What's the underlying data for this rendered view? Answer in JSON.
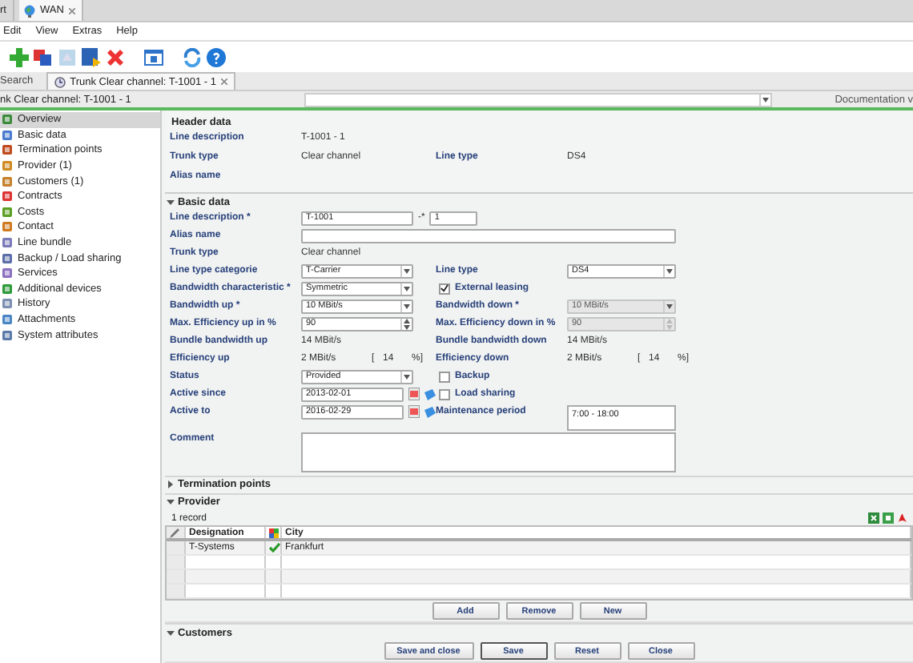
{
  "app_tabs": [
    {
      "label": "rt",
      "selected": false
    },
    {
      "label": "WAN",
      "selected": true
    }
  ],
  "menu": [
    "Edit",
    "View",
    "Extras",
    "Help"
  ],
  "search_label": "Search",
  "document_tab": {
    "label": "Trunk Clear channel: T-1001 - 1",
    "selected": true
  },
  "breadcrumb": "nk Clear channel: T-1001 - 1",
  "documentation_label": "Documentation v",
  "sidebar": {
    "items": [
      {
        "label": "Overview",
        "selected": true
      },
      {
        "label": "Basic data",
        "selected": false
      },
      {
        "label": "Termination points",
        "selected": false
      },
      {
        "label": "Provider (1)",
        "selected": false
      },
      {
        "label": "Customers (1)",
        "selected": false
      },
      {
        "label": "Contracts",
        "selected": false
      },
      {
        "label": "Costs",
        "selected": false
      },
      {
        "label": "Contact",
        "selected": false
      },
      {
        "label": "Line bundle",
        "selected": false
      },
      {
        "label": "Backup / Load sharing",
        "selected": false
      },
      {
        "label": "Services",
        "selected": false
      },
      {
        "label": "Additional devices",
        "selected": false
      },
      {
        "label": "History",
        "selected": false
      },
      {
        "label": "Attachments",
        "selected": false
      },
      {
        "label": "System attributes",
        "selected": false
      }
    ]
  },
  "header_data": {
    "title": "Header data",
    "rows": [
      {
        "left": {
          "label": "Line description",
          "kind": "text",
          "value": "T-1001 - 1"
        }
      },
      {
        "left": {
          "label": "Trunk type",
          "kind": "text",
          "value": "Clear channel"
        },
        "right": {
          "label": "Line type",
          "kind": "text",
          "value": "DS4"
        }
      },
      {
        "left": {
          "label": "Alias name",
          "kind": "text"
        }
      }
    ]
  },
  "basic_data": {
    "title": "Basic data",
    "expanded": true,
    "rows": [
      {
        "left": {
          "label": "Line description *",
          "kind": "line_id",
          "value": "T-1001",
          "separator": "-*",
          "value2": "1"
        }
      },
      {
        "left": {
          "label": "Alias name",
          "kind": "wide_input"
        }
      },
      {
        "left": {
          "label": "Trunk type",
          "kind": "text",
          "value": "Clear channel"
        }
      },
      {
        "left": {
          "label": "Line type categorie",
          "kind": "select",
          "value": "T-Carrier",
          "disabled": false
        },
        "right": {
          "label": "Line type",
          "kind": "select",
          "value": "DS4",
          "disabled": false
        }
      },
      {
        "left": {
          "label": "Bandwidth characteristic *",
          "kind": "select",
          "value": "Symmetric",
          "disabled": false
        },
        "right": {
          "label": "External leasing",
          "kind": "checkbox",
          "checked": true
        }
      },
      {
        "left": {
          "label": "Bandwidth up *",
          "kind": "select",
          "value": "10 MBit/s",
          "disabled": false
        },
        "right": {
          "label": "Bandwidth down *",
          "kind": "select",
          "value": "10 MBit/s",
          "disabled": true
        }
      },
      {
        "left": {
          "label": "Max. Efficiency up in %",
          "kind": "spinner",
          "value": "90",
          "disabled": false
        },
        "right": {
          "label": "Max. Efficiency down in %",
          "kind": "spinner",
          "value": "90",
          "disabled": true
        }
      },
      {
        "left": {
          "label": "Bundle bandwidth up",
          "kind": "text",
          "value": "14 MBit/s"
        },
        "right": {
          "label": "Bundle bandwidth down",
          "kind": "text",
          "value": "14 MBit/s"
        }
      },
      {
        "left": {
          "label": "Efficiency up",
          "kind": "efficiency",
          "value": "2 MBit/s",
          "open": "[",
          "percent": "14",
          "close": "%]"
        },
        "right": {
          "label": "Efficiency down",
          "kind": "efficiency",
          "value": "2 MBit/s",
          "open": "[",
          "percent": "14",
          "close": "%]"
        }
      },
      {
        "left": {
          "label": "Status",
          "kind": "select",
          "value": "Provided",
          "disabled": false
        },
        "right": {
          "label": "Backup",
          "kind": "checkbox",
          "checked": false
        }
      },
      {
        "left": {
          "label": "Active since",
          "kind": "date",
          "value": "2013-02-01"
        },
        "right": {
          "label": "Load sharing",
          "kind": "checkbox",
          "checked": false
        }
      },
      {
        "left": {
          "label": "Active to",
          "kind": "date",
          "value": "2016-02-29"
        },
        "right": {
          "label": "Maintenance period",
          "kind": "textarea",
          "value": "7:00 - 18:00"
        }
      },
      {
        "left": {
          "label": "Comment",
          "kind": "wide_textarea"
        }
      }
    ]
  },
  "termination_points": {
    "title": "Termination points",
    "expanded": false
  },
  "provider": {
    "title": "Provider",
    "expanded": true,
    "record_count": "1 record",
    "columns": [
      "Designation",
      "City"
    ],
    "rows": [
      {
        "designation": "T-Systems",
        "checked": true,
        "city": "Frankfurt"
      }
    ],
    "buttons": [
      "Add",
      "Remove",
      "New"
    ]
  },
  "customers": {
    "title": "Customers",
    "expanded": true
  },
  "footer_buttons": [
    {
      "label": "Save and close",
      "focused": false
    },
    {
      "label": "Save",
      "focused": true
    },
    {
      "label": "Reset",
      "focused": false
    },
    {
      "label": "Close",
      "focused": false
    }
  ]
}
